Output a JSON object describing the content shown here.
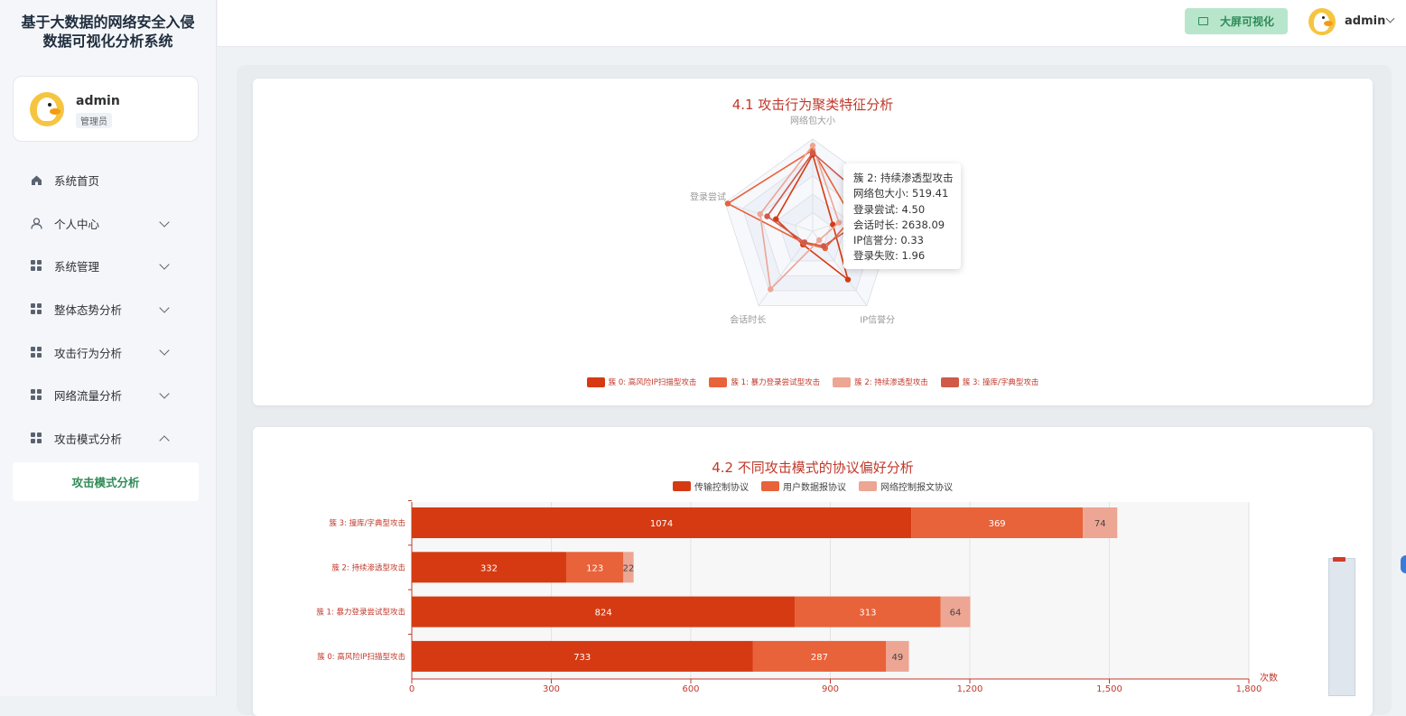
{
  "app": {
    "title": "基于大数据的网络安全入侵数据可视化分析系统"
  },
  "user_card": {
    "name": "admin",
    "role": "管理员"
  },
  "menu": [
    {
      "label": "系统首页",
      "icon": "home-icon",
      "chevron": ""
    },
    {
      "label": "个人中心",
      "icon": "user-icon",
      "chevron": "down"
    },
    {
      "label": "系统管理",
      "icon": "grid-icon",
      "chevron": "down"
    },
    {
      "label": "整体态势分析",
      "icon": "grid-icon",
      "chevron": "down"
    },
    {
      "label": "攻击行为分析",
      "icon": "grid-icon",
      "chevron": "down"
    },
    {
      "label": "网络流量分析",
      "icon": "grid-icon",
      "chevron": "down"
    },
    {
      "label": "攻击模式分析",
      "icon": "grid-icon",
      "chevron": "up"
    }
  ],
  "submenu": {
    "active": "攻击模式分析"
  },
  "header": {
    "bigscreen_label": "大屏可视化",
    "user": "admin"
  },
  "colors": {
    "c0": "#d63a12",
    "c1": "#e8623a",
    "c2": "#eda594",
    "c3": "#cf5a4a",
    "accent": "#2e8b57"
  },
  "radar": {
    "title": "4.1 攻击行为聚类特征分析",
    "indicators": [
      "网络包大小",
      "登录失败",
      "IP信誉分",
      "会话时长",
      "登录尝试"
    ],
    "series": [
      {
        "name": "簇 0: 高风险IP扫描型攻击",
        "values": [
          0.83,
          0.23,
          0.65,
          0.18,
          0.42
        ]
      },
      {
        "name": "簇 1: 暴力登录尝试型攻击",
        "values": [
          0.88,
          0.45,
          0.23,
          0.16,
          0.97
        ]
      },
      {
        "name": "簇 2: 持续渗透型攻击",
        "values": [
          0.93,
          0.3,
          0.12,
          0.78,
          0.6
        ]
      },
      {
        "name": "簇 3: 撞库/字典型攻击",
        "values": [
          0.85,
          0.75,
          0.2,
          0.15,
          0.52
        ]
      }
    ],
    "tooltip": {
      "title": "簇 2: 持续渗透型攻击",
      "lines": [
        "网络包大小: 519.41",
        "登录尝试: 4.50",
        "会话时长: 2638.09",
        "IP信誉分: 0.33",
        "登录失败: 1.96"
      ]
    }
  },
  "chart_data": {
    "type": "bar",
    "title": "4.2 不同攻击模式的协议偏好分析",
    "categories": [
      "簇 3: 撞库/字典型攻击",
      "簇 2: 持续渗透型攻击",
      "簇 1: 暴力登录尝试型攻击",
      "簇 0: 高风险IP扫描型攻击"
    ],
    "series": [
      {
        "name": "传输控制协议",
        "values": [
          1074,
          332,
          824,
          733
        ]
      },
      {
        "name": "用户数据报协议",
        "values": [
          369,
          123,
          313,
          287
        ]
      },
      {
        "name": "网络控制报文协议",
        "values": [
          74,
          22,
          64,
          49
        ]
      }
    ],
    "stacked": true,
    "orientation": "horizontal",
    "xlabel": "次数",
    "xlim": [
      0,
      1800
    ],
    "xticks": [
      "0",
      "300",
      "600",
      "900",
      "1,200",
      "1,500",
      "1,800"
    ],
    "legend": "top-center"
  }
}
